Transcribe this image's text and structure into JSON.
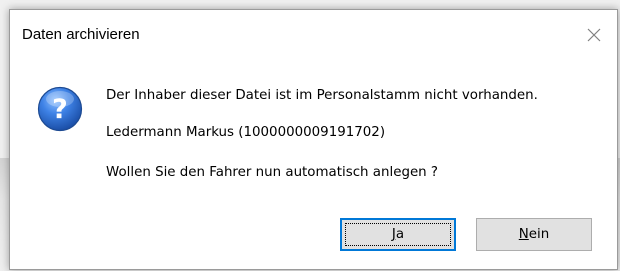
{
  "dialog": {
    "title": "Daten archivieren",
    "close_icon": "close-icon",
    "icon": "question-icon",
    "messages": {
      "line1": "Der Inhaber dieser Datei ist im Personalstamm nicht vorhanden.",
      "line2": "Ledermann Markus (1000000009191702)",
      "line3": "Wollen Sie den Fahrer nun automatisch anlegen ?"
    },
    "buttons": {
      "yes_access": "J",
      "yes_rest": "a",
      "no_access": "N",
      "no_rest": "ein"
    }
  },
  "colors": {
    "accent": "#0078d7",
    "icon_blue": "#2f6fd0",
    "button_bg": "#e1e1e1"
  }
}
